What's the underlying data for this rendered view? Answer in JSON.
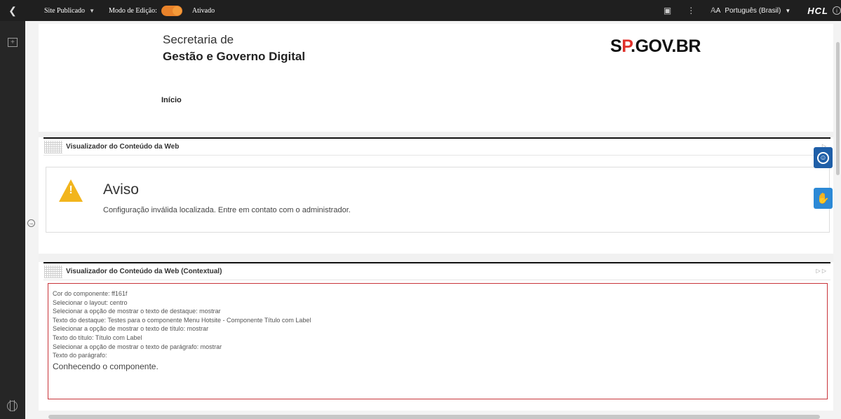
{
  "topbar": {
    "back_icon": "chevron-left-icon",
    "site_published": "Site Publicado",
    "edit_mode_label": "Modo de Edição:",
    "edit_mode_state": "Ativado",
    "language": "Português (Brasil)",
    "brand": "HCL",
    "accent_color": "#e8822a"
  },
  "header": {
    "secretaria_line1": "Secretaria de",
    "secretaria_line2": "Gestão e Governo Digital",
    "logo_prefix": "SP",
    "logo_suffix": ".GOV.BR",
    "nav_inicio": "Início"
  },
  "portlet1": {
    "title": "Visualizador do Conteúdo da Web",
    "warning_title": "Aviso",
    "warning_message": "Configuração inválida localizada. Entre em contato com o administrador."
  },
  "portlet2": {
    "title": "Visualizador do Conteúdo da Web (Contextual)",
    "lines": [
      "Cor do componente: ff161f",
      "Selecionar o layout: centro",
      "Selecionar a opção de mostrar o texto de destaque: mostrar",
      "Texto do destaque: Testes para o componente Menu Hotsite - Componente Título com Label",
      "Selecionar a opção de mostrar o texto de título: mostrar",
      "Texto do título: Título com Label",
      "Selecionar a opção de mostrar o texto de parágrafo: mostrar",
      "Texto do parágrafo:"
    ],
    "paragraph": "Conhecendo o componente."
  }
}
